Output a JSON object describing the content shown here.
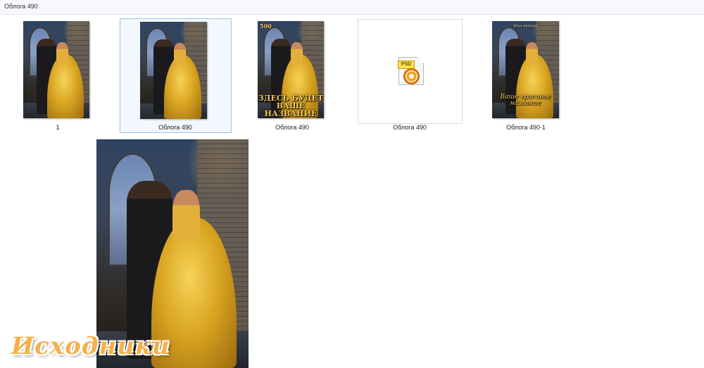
{
  "window": {
    "title": "Облога 490"
  },
  "files": [
    {
      "name": "1"
    },
    {
      "name": "Облога  490"
    },
    {
      "name": "Облога 490",
      "corner_text": "500",
      "overlay_text": "ЗДЕСЬ БУДЕТ ВАШЕ НАЗВАНИЕ"
    },
    {
      "name": "Облога 490",
      "icon": "psd-file-icon",
      "icon_label": "PSD"
    },
    {
      "name": "Облога 490-1",
      "author_text": "Имя Автора",
      "overlay_text": "Ваше красивое название"
    }
  ],
  "watermark": {
    "text": "Исходники",
    "color": "#f6b04a"
  },
  "colors": {
    "selection_border": "#9ec3ec",
    "selection_fill": "#f3f8fe"
  }
}
